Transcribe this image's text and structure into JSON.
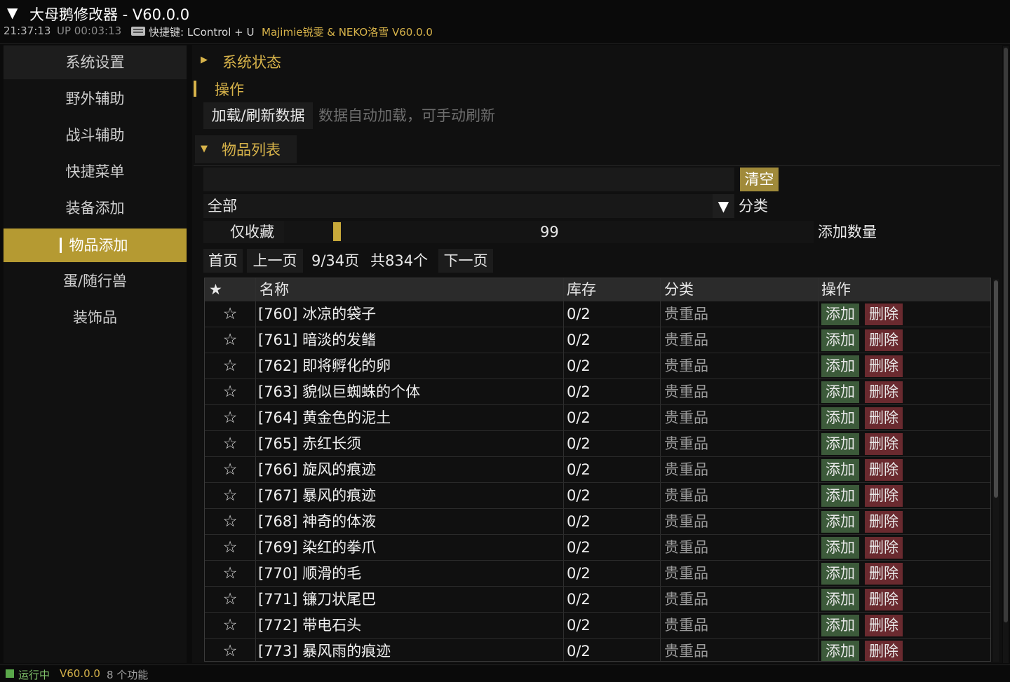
{
  "window": {
    "title": "大母鹅修改器 - V60.0.0",
    "time": "21:37:13",
    "uptime": "UP 00:03:13",
    "hotkey": "快捷键: LControl + U",
    "author": "Majimie锐雯 & NEKO洛雪 V60.0.0"
  },
  "sidebar": {
    "items": [
      {
        "label": "系统设置"
      },
      {
        "label": "野外辅助"
      },
      {
        "label": "战斗辅助"
      },
      {
        "label": "快捷菜单"
      },
      {
        "label": "装备添加"
      },
      {
        "label": "物品添加",
        "active": true
      },
      {
        "label": "蛋/随行兽"
      },
      {
        "label": "装饰品"
      }
    ]
  },
  "main": {
    "system_status": "系统状态",
    "operations": "操作",
    "load_button": "加载/刷新数据",
    "load_hint": "数据自动加载，可手动刷新",
    "item_list": "物品列表",
    "search_placeholder": "",
    "clear_button": "清空",
    "category_value": "全部",
    "category_label": "分类",
    "favorites_only": "仅收藏",
    "quantity_value": "99",
    "quantity_label": "添加数量",
    "quantity_fraction": 0.1
  },
  "pager": {
    "first": "首页",
    "prev": "上一页",
    "page_info": "9/34页",
    "total": "共834个",
    "next": "下一页"
  },
  "table": {
    "headers": {
      "star": "★",
      "name": "名称",
      "stock": "库存",
      "category": "分类",
      "action": "操作"
    },
    "add_label": "添加",
    "delete_label": "删除",
    "rows": [
      {
        "star": "☆",
        "name": "[760] 冰凉的袋子",
        "stock": "0/2",
        "category": "贵重品"
      },
      {
        "star": "☆",
        "name": "[761] 暗淡的发鳍",
        "stock": "0/2",
        "category": "贵重品"
      },
      {
        "star": "☆",
        "name": "[762] 即将孵化的卵",
        "stock": "0/2",
        "category": "贵重品"
      },
      {
        "star": "☆",
        "name": "[763] 貌似巨蜘蛛的个体",
        "stock": "0/2",
        "category": "贵重品"
      },
      {
        "star": "☆",
        "name": "[764] 黄金色的泥土",
        "stock": "0/2",
        "category": "贵重品"
      },
      {
        "star": "☆",
        "name": "[765] 赤红长须",
        "stock": "0/2",
        "category": "贵重品"
      },
      {
        "star": "☆",
        "name": "[766] 旋风的痕迹",
        "stock": "0/2",
        "category": "贵重品"
      },
      {
        "star": "☆",
        "name": "[767] 暴风的痕迹",
        "stock": "0/2",
        "category": "贵重品"
      },
      {
        "star": "☆",
        "name": "[768] 神奇的体液",
        "stock": "0/2",
        "category": "贵重品"
      },
      {
        "star": "☆",
        "name": "[769] 染红的拳爪",
        "stock": "0/2",
        "category": "贵重品"
      },
      {
        "star": "☆",
        "name": "[770] 顺滑的毛",
        "stock": "0/2",
        "category": "贵重品"
      },
      {
        "star": "☆",
        "name": "[771] 镰刀状尾巴",
        "stock": "0/2",
        "category": "贵重品"
      },
      {
        "star": "☆",
        "name": "[772] 带电石头",
        "stock": "0/2",
        "category": "贵重品"
      },
      {
        "star": "☆",
        "name": "[773] 暴风雨的痕迹",
        "stock": "0/2",
        "category": "贵重品"
      }
    ]
  },
  "status": {
    "running": "运行中",
    "version": "V60.0.0",
    "features": "8 个功能"
  },
  "colors": {
    "accent": "#d7b34a",
    "active_bg": "#b59a32",
    "add_bg": "#3c5a3a",
    "delete_bg": "#6a2a2f"
  }
}
